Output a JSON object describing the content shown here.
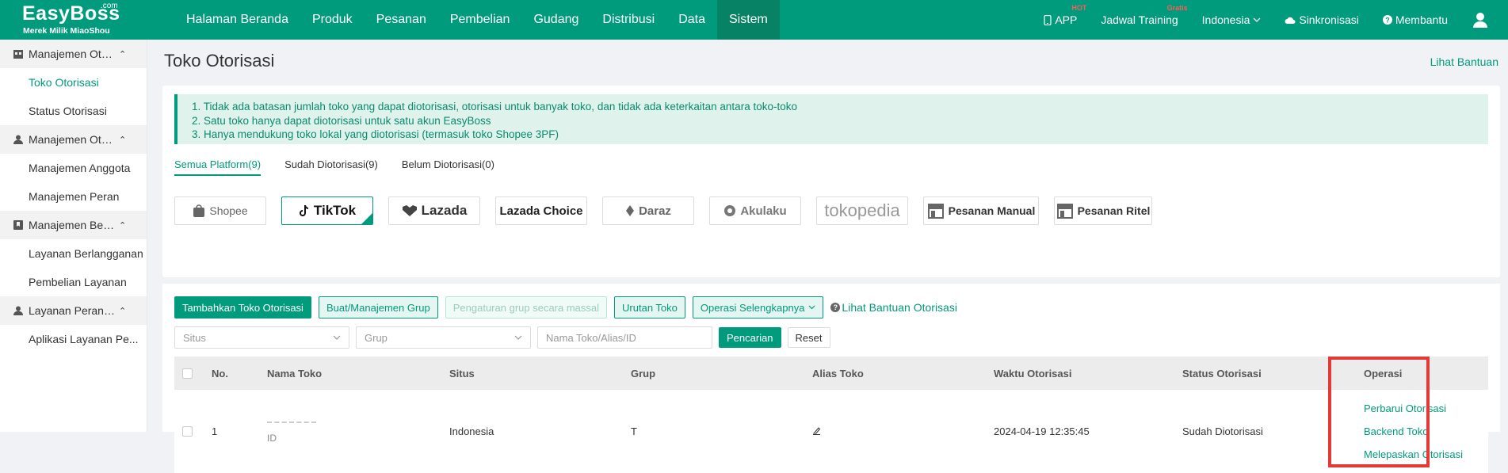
{
  "brand": {
    "name": "EasyBoss",
    "com": ".com",
    "subtitle": "Merek Milik MiaoShou"
  },
  "nav": [
    "Halaman Beranda",
    "Produk",
    "Pesanan",
    "Pembelian",
    "Gudang",
    "Distribusi",
    "Data",
    "Sistem"
  ],
  "nav_active": "Sistem",
  "right_nav": {
    "app": "APP",
    "app_badge": "HOT",
    "training": "Jadwal Training",
    "training_badge": "Gratis",
    "language": "Indonesia",
    "sync": "Sinkronisasi",
    "help": "Membantu"
  },
  "sidebar": [
    {
      "label": "Manajemen Otorisasi",
      "items": [
        "Toko Otorisasi",
        "Status Otorisasi"
      ]
    },
    {
      "label": "Manajemen Otoritas",
      "items": [
        "Manajemen Anggota",
        "Manajemen Peran"
      ]
    },
    {
      "label": "Manajemen Berlangganan",
      "items": [
        "Layanan Berlangganan",
        "Pembelian Layanan"
      ]
    },
    {
      "label": "Layanan Perangkat",
      "items": [
        "Aplikasi Layanan Pe..."
      ]
    }
  ],
  "sidebar_active": "Toko Otorisasi",
  "page": {
    "title": "Toko Otorisasi",
    "help": "Lihat Bantuan"
  },
  "notice": [
    "1. Tidak ada batasan jumlah toko yang dapat diotorisasi, otorisasi untuk banyak toko, dan tidak ada keterkaitan antara toko-toko",
    "2. Satu toko hanya dapat diotorisasi untuk satu akun EasyBoss",
    "3. Hanya mendukung toko lokal yang diotorisasi (termasuk toko Shopee 3PF)"
  ],
  "platform_tabs": [
    "Semua Platform(9)",
    "Sudah Diotorisasi(9)",
    "Belum Diotorisasi(0)"
  ],
  "platforms": [
    "Shopee",
    "TikTok",
    "Lazada",
    "Lazada Choice",
    "Daraz",
    "Akulaku",
    "tokopedia",
    "Pesanan Manual",
    "Pesanan Ritel"
  ],
  "selected_platform": "TikTok",
  "buttons": {
    "add": "Tambahkan Toko Otorisasi",
    "group": "Buat/Manajemen Grup",
    "batch": "Pengaturan grup secara massal",
    "order": "Urutan Toko",
    "more": "Operasi Selengkapnya",
    "help": "Lihat Bantuan Otorisasi"
  },
  "filters": {
    "site": "Situs",
    "group": "Grup",
    "search": "Nama Toko/Alias/ID",
    "search_btn": "Pencarian",
    "reset": "Reset"
  },
  "table": {
    "headers": [
      "No.",
      "Nama Toko",
      "Situs",
      "Grup",
      "Alias Toko",
      "Waktu Otorisasi",
      "Status Otorisasi",
      "Operasi"
    ],
    "rows": [
      {
        "no": "1",
        "store_sub": "ID",
        "site": "Indonesia",
        "group": "T",
        "time": "2024-04-19 12:35:45",
        "status": "Sudah Diotorisasi",
        "ops": [
          "Perbarui Otorisasi",
          "Backend Toko",
          "Melepaskan Otorisasi"
        ]
      }
    ]
  },
  "colors": {
    "brand": "#009b7d",
    "highlight": "#e53935"
  }
}
